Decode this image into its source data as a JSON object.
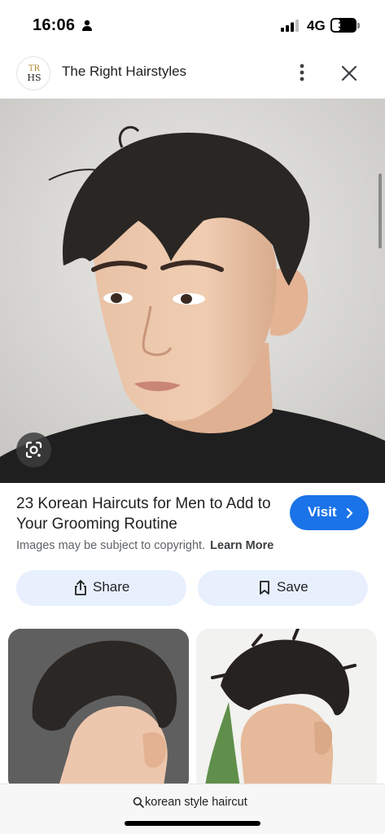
{
  "status_bar": {
    "time": "16:06",
    "network": "4G",
    "battery_level": "36",
    "battery_fraction": 0.36
  },
  "header": {
    "logo_text_top": "TR",
    "logo_text_bottom": "HS",
    "site_name": "The Right Hairstyles",
    "more_icon": "more-vertical-icon",
    "close_icon": "close-icon"
  },
  "main_image": {
    "lens_icon": "google-lens-icon"
  },
  "result": {
    "title": "23 Korean Haircuts for Men to Add to Your Grooming Routine",
    "visit_label": "Visit",
    "copyright_text": "Images may be subject to copyright.",
    "learn_more": "Learn More"
  },
  "actions": {
    "share_label": "Share",
    "share_icon": "share-icon",
    "save_label": "Save",
    "save_icon": "bookmark-icon"
  },
  "search": {
    "query": "korean style haircut",
    "icon": "search-icon"
  },
  "colors": {
    "accent": "#1a73e8",
    "action_bg": "#e8f0fe"
  }
}
